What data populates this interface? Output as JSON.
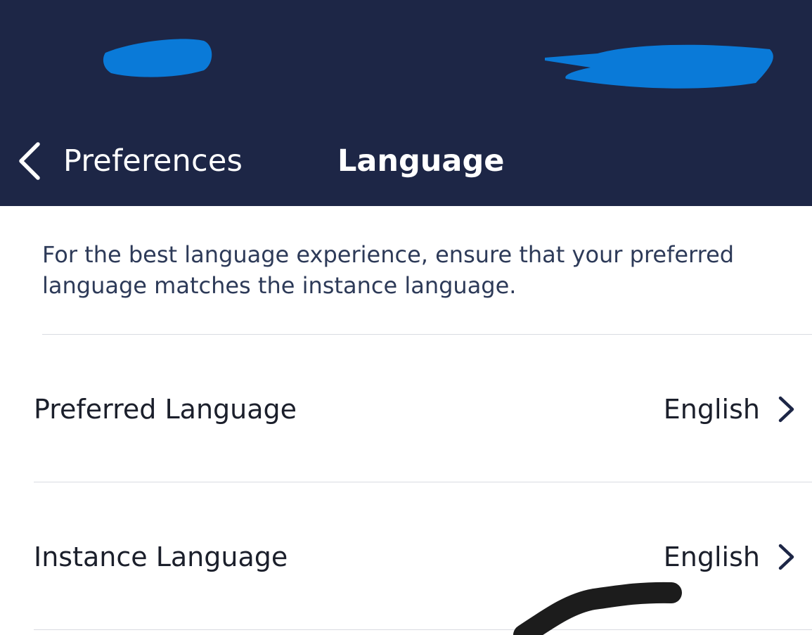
{
  "header": {
    "back_label": "Preferences",
    "title": "Language",
    "background_color": "#1d2646",
    "redaction_color": "#0a7ad8"
  },
  "description": "For the best language experience, ensure that your preferred language matches the instance language.",
  "settings": [
    {
      "label": "Preferred Language",
      "value": "English"
    },
    {
      "label": "Instance Language",
      "value": "English"
    }
  ],
  "icons": {
    "back": "chevron-left-icon",
    "disclosure": "chevron-right-icon"
  }
}
